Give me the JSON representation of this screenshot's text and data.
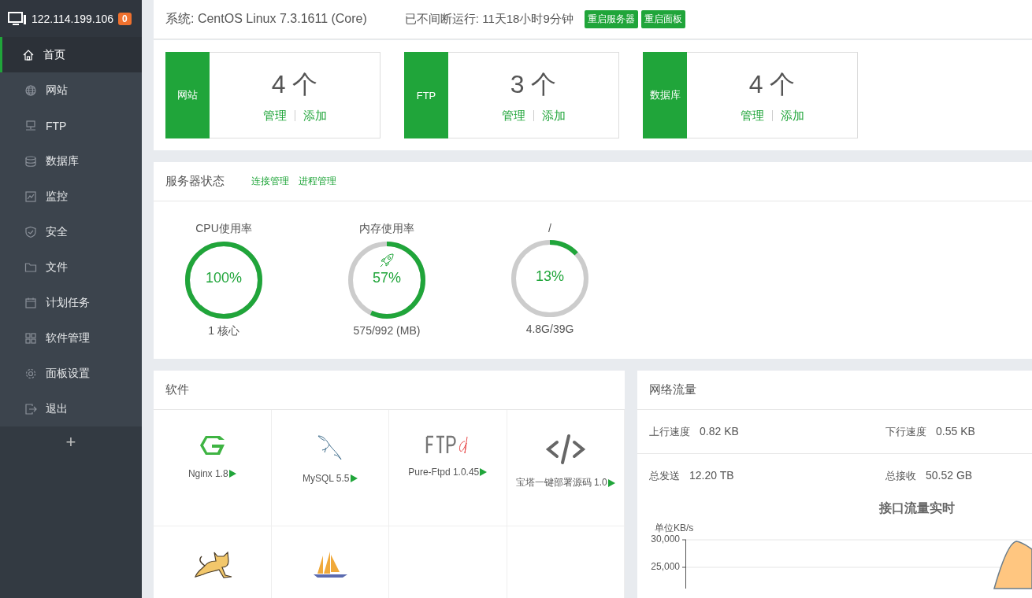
{
  "sidebar": {
    "host": "122.114.199.106",
    "badge": "0",
    "items": [
      {
        "label": "首页",
        "selected": true
      },
      {
        "label": "网站",
        "selected": false
      },
      {
        "label": "FTP",
        "selected": false
      },
      {
        "label": "数据库",
        "selected": false
      },
      {
        "label": "监控",
        "selected": false
      },
      {
        "label": "安全",
        "selected": false
      },
      {
        "label": "文件",
        "selected": false
      },
      {
        "label": "计划任务",
        "selected": false
      },
      {
        "label": "软件管理",
        "selected": false
      },
      {
        "label": "面板设置",
        "selected": false
      },
      {
        "label": "退出",
        "selected": false
      }
    ],
    "add": "+"
  },
  "topbar": {
    "system": "系统: CentOS Linux 7.3.1611 (Core)",
    "uptime": "已不间断运行: 11天18小时9分钟",
    "buttons": [
      "重启服务器",
      "重启面板"
    ]
  },
  "stats": [
    {
      "label": "网站",
      "count": "4 个",
      "links": [
        "管理",
        "添加"
      ]
    },
    {
      "label": "FTP",
      "count": "3 个",
      "links": [
        "管理",
        "添加"
      ]
    },
    {
      "label": "数据库",
      "count": "4 个",
      "links": [
        "管理",
        "添加"
      ]
    }
  ],
  "server_status": {
    "title": "服务器状态",
    "links": [
      "连接管理",
      "进程管理"
    ],
    "gauges": [
      {
        "title": "CPU使用率",
        "value": "100%",
        "level": 1,
        "detail": "1 核心"
      },
      {
        "title": "内存使用率",
        "value": "57%",
        "level": 0.57,
        "detail": "575/992 (MB)"
      },
      {
        "title": "/",
        "value": "13%",
        "level": 0.13,
        "detail": "4.8G/39G"
      }
    ]
  },
  "software": {
    "title": "软件",
    "items": [
      {
        "label": "Nginx 1.8"
      },
      {
        "label": "MySQL 5.5"
      },
      {
        "label": "Pure-Ftpd 1.0.45"
      },
      {
        "label": "宝塔一键部署源码 1.0"
      }
    ]
  },
  "network": {
    "title": "网络流量",
    "rows": [
      [
        {
          "label": "上行速度",
          "value": "0.82 KB"
        },
        {
          "label": "下行速度",
          "value": "0.55 KB"
        }
      ],
      [
        {
          "label": "总发送",
          "value": "12.20 TB"
        },
        {
          "label": "总接收",
          "value": "50.52 GB"
        }
      ]
    ],
    "chart": {
      "title": "接口流量实时",
      "unit": "单位KB/s",
      "y_ticks": [
        "30,000",
        "25,000"
      ]
    }
  }
}
